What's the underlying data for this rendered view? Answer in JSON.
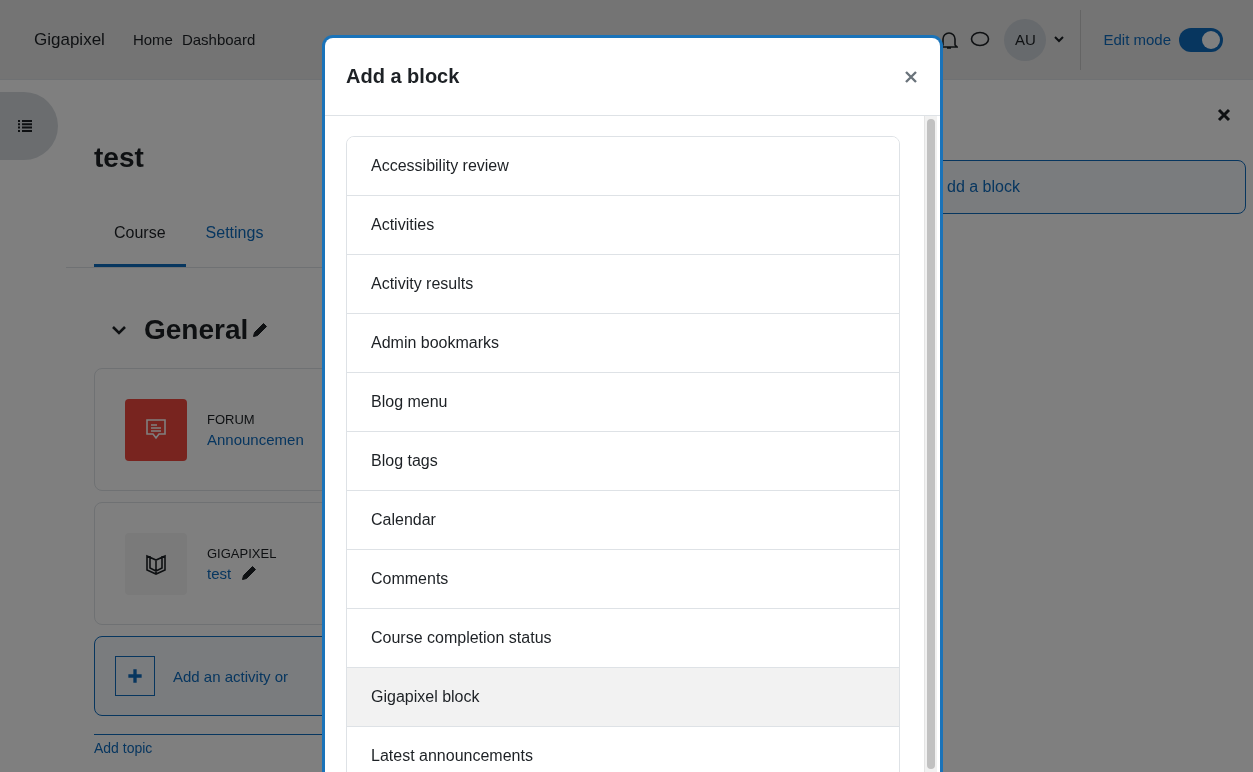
{
  "navbar": {
    "brand": "Gigapixel",
    "links": [
      {
        "label": "Home",
        "selected": false
      },
      {
        "label": "Dashboard",
        "selected": false
      }
    ],
    "user_initials": "AU",
    "edit_mode": {
      "label": "Edit mode",
      "on": true
    }
  },
  "course": {
    "title": "test",
    "tabs": [
      {
        "label": "Course",
        "selected": true
      },
      {
        "label": "Settings",
        "selected": false
      }
    ],
    "section": {
      "title": "General",
      "expanded": true,
      "activities": [
        {
          "kind": "forum",
          "type_label": "FORUM",
          "name": "Announcemen",
          "editable": false
        },
        {
          "kind": "book",
          "type_label": "GIGAPIXEL",
          "name": "test",
          "editable": true
        }
      ],
      "add_activity": "Add an activity or"
    },
    "add_topic": "Add topic"
  },
  "block_drawer": {
    "add_block_button": "dd a block"
  },
  "modal": {
    "title": "Add a block",
    "items": [
      {
        "label": "Accessibility review",
        "selected": false
      },
      {
        "label": "Activities",
        "selected": false
      },
      {
        "label": "Activity results",
        "selected": false
      },
      {
        "label": "Admin bookmarks",
        "selected": false
      },
      {
        "label": "Blog menu",
        "selected": false
      },
      {
        "label": "Blog tags",
        "selected": false
      },
      {
        "label": "Calendar",
        "selected": false
      },
      {
        "label": "Comments",
        "selected": false
      },
      {
        "label": "Course completion status",
        "selected": false
      },
      {
        "label": "Gigapixel block",
        "selected": true
      },
      {
        "label": "Latest announcements",
        "selected": false
      }
    ]
  }
}
